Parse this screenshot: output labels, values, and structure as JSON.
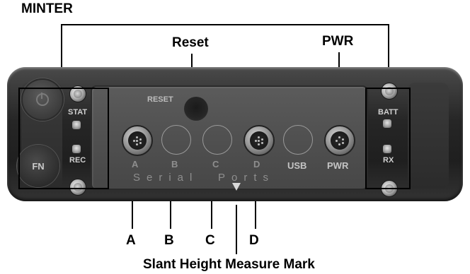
{
  "callouts": {
    "minter": "MINTER",
    "reset": "Reset",
    "pwr": "PWR",
    "a": "A",
    "b": "B",
    "c": "C",
    "d": "D",
    "slant": "Slant Height Measure Mark"
  },
  "device": {
    "reset_label": "RESET",
    "stat_label": "STAT",
    "rec_label": "REC",
    "fn_label": "FN",
    "batt_label": "BATT",
    "rx_label": "RX",
    "usb_label": "USB",
    "pwr_label": "PWR",
    "port_letters": [
      "A",
      "B",
      "C",
      "D"
    ],
    "serial_text": "Serial",
    "ports_text": "Ports"
  },
  "colors": {
    "device_body": "#262626",
    "panel": "#505050",
    "label_text": "#d0d0d0"
  }
}
